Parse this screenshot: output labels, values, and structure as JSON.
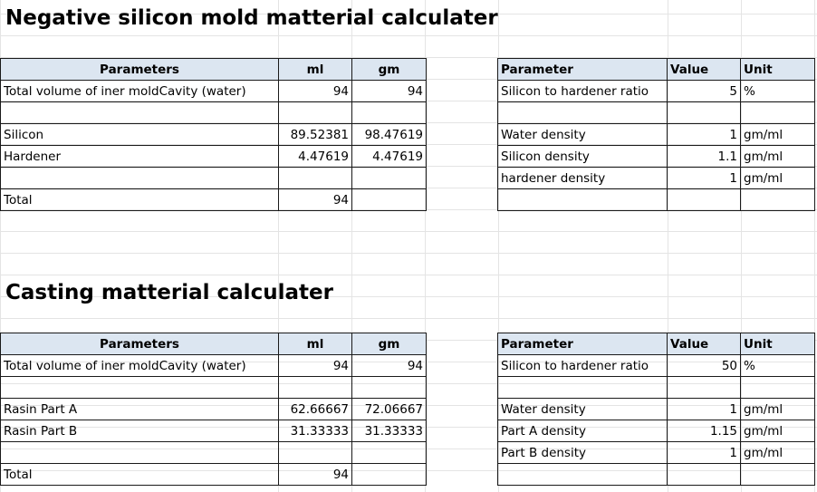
{
  "section1": {
    "title": "Negative silicon mold matterial calculater",
    "left": {
      "headers": [
        "Parameters",
        "ml",
        "gm"
      ],
      "rows": [
        [
          "Total volume of iner moldCavity (water)",
          "94",
          "94"
        ],
        [
          "",
          "",
          ""
        ],
        [
          "Silicon",
          "89.52381",
          "98.47619"
        ],
        [
          "Hardener",
          "4.47619",
          "4.47619"
        ],
        [
          "",
          "",
          ""
        ],
        [
          "Total",
          "94",
          ""
        ]
      ]
    },
    "right": {
      "headers": [
        "Parameter",
        "Value",
        "Unit"
      ],
      "rows": [
        [
          "Silicon to hardener ratio",
          "5",
          "%"
        ],
        [
          "",
          "",
          ""
        ],
        [
          "Water density",
          "1",
          "gm/ml"
        ],
        [
          "Silicon density",
          "1.1",
          "gm/ml"
        ],
        [
          "hardener density",
          "1",
          "gm/ml"
        ],
        [
          "",
          "",
          ""
        ]
      ]
    }
  },
  "section2": {
    "title": "Casting matterial calculater",
    "left": {
      "headers": [
        "Parameters",
        "ml",
        "gm"
      ],
      "rows": [
        [
          "Total volume of iner moldCavity (water)",
          "94",
          "94"
        ],
        [
          "",
          "",
          ""
        ],
        [
          "Rasin Part A",
          "62.66667",
          "72.06667"
        ],
        [
          "Rasin Part B",
          "31.33333",
          "31.33333"
        ],
        [
          "",
          "",
          ""
        ],
        [
          "Total",
          "94",
          ""
        ]
      ]
    },
    "right": {
      "headers": [
        "Parameter",
        "Value",
        "Unit"
      ],
      "rows": [
        [
          "Silicon to hardener ratio",
          "50",
          "%"
        ],
        [
          "",
          "",
          ""
        ],
        [
          "Water density",
          "1",
          "gm/ml"
        ],
        [
          "Part A density",
          "1.15",
          "gm/ml"
        ],
        [
          "Part B density",
          "1",
          "gm/ml"
        ],
        [
          "",
          "",
          ""
        ]
      ]
    }
  }
}
